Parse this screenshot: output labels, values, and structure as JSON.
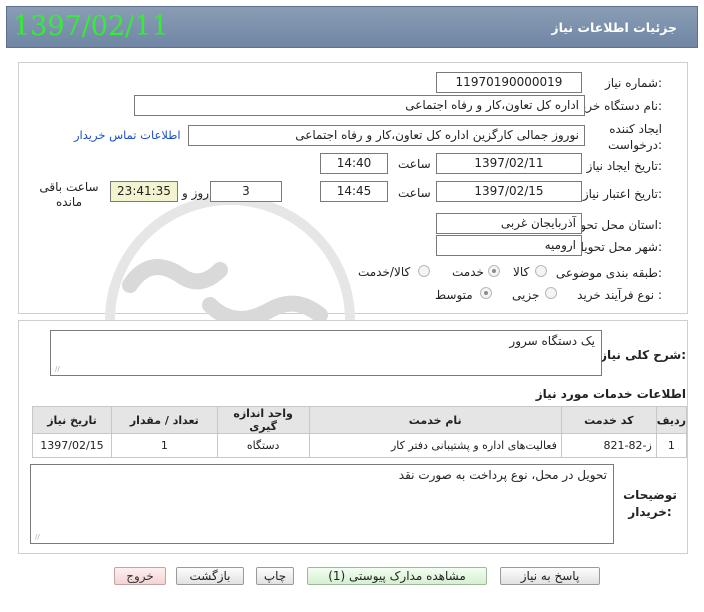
{
  "header": {
    "title": "جزئیات اطلاعات نیاز",
    "date": "1397/02/11"
  },
  "form": {
    "need_number_label": "شماره نیاز:",
    "need_number": "11970190000019",
    "buyer_org_label": "نام دستگاه خریدار:",
    "buyer_org": "اداره کل تعاون،کار و رفاه اجتماعی",
    "requester_label_1": "ایجاد کننده",
    "requester_label_2": "درخواست:",
    "requester": "نوروز جمالی کارگزین اداره کل تعاون،کار و رفاه اجتماعی",
    "buyer_contact_link": "اطلاعات تماس خریدار",
    "created_date_label": "تاریخ ایجاد نیاز:",
    "created_date": "1397/02/11",
    "hour_label": "ساعت",
    "created_time": "14:40",
    "valid_date_label": "تاریخ اعتبار نیاز:",
    "valid_date": "1397/02/15",
    "valid_time": "14:45",
    "days_value": "3",
    "days_label": "روز و",
    "remaining_time": "23:41:35",
    "remaining_label_1": "ساعت باقی",
    "remaining_label_2": "مانده",
    "province_label": "استان محل تحویل:",
    "province": "آذربایجان غربی",
    "city_label": "شهر محل تحویل:",
    "city": "ارومیه",
    "category_label": "طبقه بندی موضوعی:",
    "category_options": [
      "کالا",
      "خدمت",
      "کالا/خدمت"
    ],
    "category_selected": "خدمت",
    "process_label": "نوع فرآیند خرید :",
    "process_options": [
      "جزیی",
      "متوسط"
    ],
    "process_selected": "متوسط"
  },
  "summary": {
    "label": "شرح کلی نیاز:",
    "text": "یک دستگاه سرور"
  },
  "services": {
    "section_title": "اطلاعات خدمات مورد نیاز",
    "columns": [
      "ردیف",
      "کد خدمت",
      "نام خدمت",
      "واحد اندازه گیری",
      "تعداد / مقدار",
      "تاریخ نیاز"
    ],
    "rows": [
      [
        "1",
        "ز-82-821",
        "فعالیت‌های اداره و پشتیبانی دفتر کار",
        "دستگاه",
        "1",
        "1397/02/15"
      ]
    ]
  },
  "notes": {
    "label_1": "توضیحات",
    "label_2": "خریدار:",
    "text": "تحویل در محل، نوع پرداخت به صورت نقد"
  },
  "buttons": {
    "reply": "پاسخ به نیاز",
    "attachments": "مشاهده مدارک پیوستی (1)",
    "print": "چاپ",
    "back": "بازگشت",
    "exit": "خروج"
  }
}
